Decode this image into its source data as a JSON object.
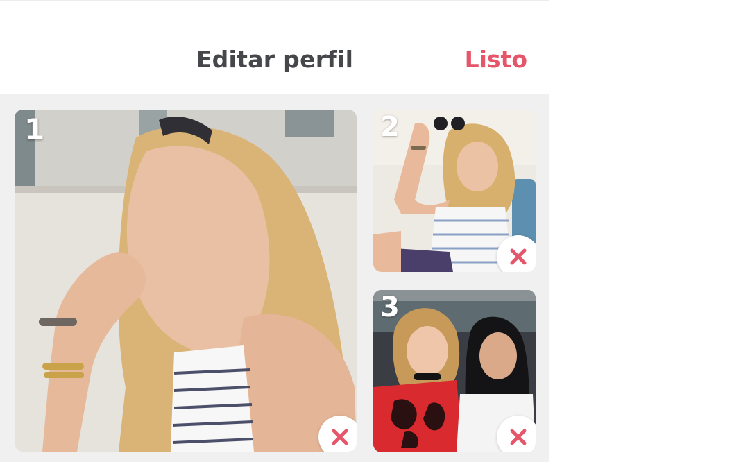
{
  "header": {
    "title": "Editar perfil",
    "done_label": "Listo"
  },
  "colors": {
    "accent": "#e5566b",
    "title_text": "#46474a",
    "grid_background": "#f0f0f0"
  },
  "photos": [
    {
      "number": "1",
      "icon": "remove-icon"
    },
    {
      "number": "2",
      "icon": "remove-icon"
    },
    {
      "number": "3",
      "icon": "remove-icon"
    }
  ]
}
